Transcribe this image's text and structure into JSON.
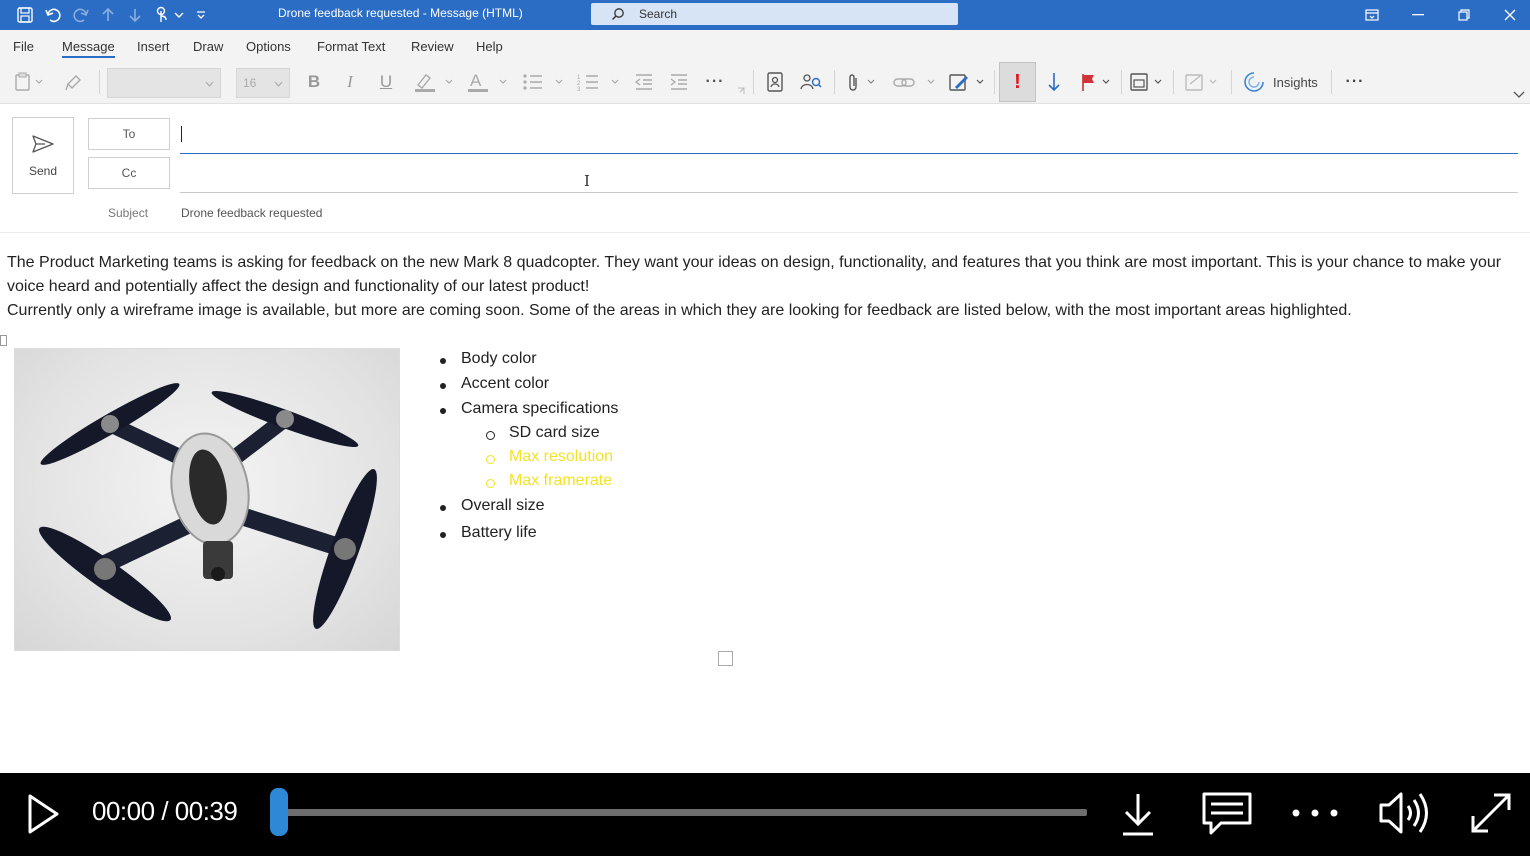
{
  "window": {
    "title": "Drone feedback requested  -  Message (HTML)",
    "search_placeholder": "Search"
  },
  "menu": {
    "tabs": [
      "File",
      "Message",
      "Insert",
      "Draw",
      "Options",
      "Format Text",
      "Review",
      "Help"
    ],
    "active": "Message"
  },
  "ribbon": {
    "font_size": "16",
    "insights_label": "Insights",
    "icons": [
      "paste-icon",
      "format-painter-icon",
      "bold-icon",
      "italic-icon",
      "underline-icon",
      "highlight-icon",
      "font-color-icon",
      "bullets-icon",
      "numbering-icon",
      "decrease-indent-icon",
      "increase-indent-icon",
      "more-icon",
      "address-book-icon",
      "check-names-icon",
      "attach-file-icon",
      "link-icon",
      "signature-icon",
      "high-importance-icon",
      "low-importance-icon",
      "follow-up-flag-icon",
      "templates-icon",
      "sensitivity-icon",
      "insights-icon",
      "more-options-icon",
      "collapse-ribbon-icon"
    ]
  },
  "compose": {
    "send_label": "Send",
    "to_label": "To",
    "cc_label": "Cc",
    "to_value": "",
    "cc_value": "",
    "subject_label": "Subject",
    "subject_value": "Drone feedback requested"
  },
  "body": {
    "paragraph1": "The Product Marketing teams is asking for feedback on the new Mark 8 quadcopter. They want your ideas on design, functionality, and features that you think are most important. This is your chance to make your voice heard and potentially affect the design and functionality of our latest product!",
    "paragraph2": "Currently only a wireframe image is available, but more are coming soon. Some of the areas in which they are looking for feedback are listed below, with the most important areas highlighted.",
    "list": {
      "body_color": "Body color",
      "accent_color": "Accent color",
      "camera_specs": "Camera specifications",
      "sd_card": "SD card size",
      "max_resolution": "Max resolution",
      "max_framerate": "Max framerate",
      "overall_size": "Overall size",
      "battery_life": "Battery life"
    },
    "highlight_color": "#f4e224"
  },
  "player": {
    "current_time": "00:00",
    "separator": "/",
    "duration": "00:39",
    "progress": 0.0,
    "accent": "#2f88d6"
  }
}
